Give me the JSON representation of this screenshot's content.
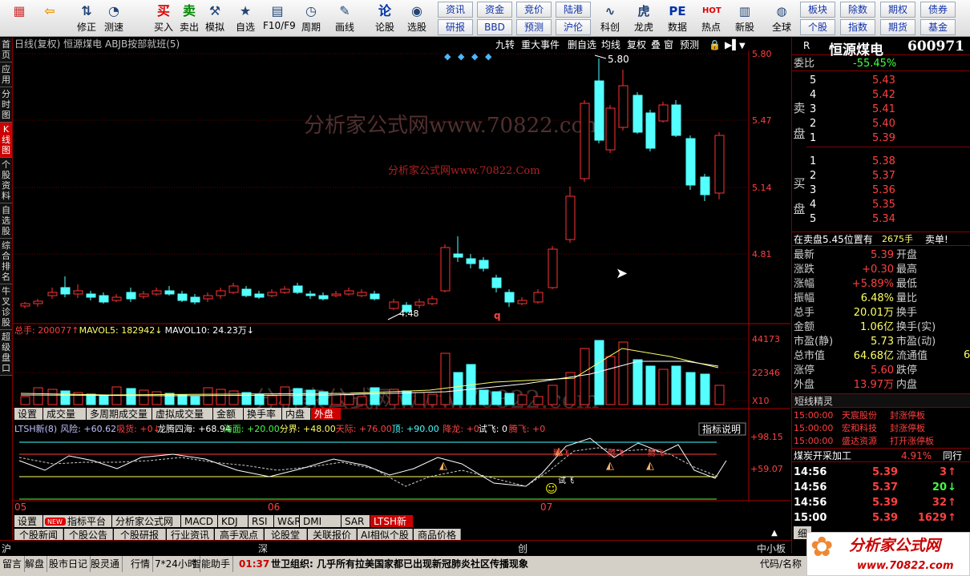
{
  "toolbar": {
    "buttons": [
      {
        "label": "",
        "icon": "grid-icon"
      },
      {
        "label": "",
        "icon": "back-arrow-icon"
      },
      {
        "label": "修正",
        "icon": "up-down-icon"
      },
      {
        "label": "测速",
        "icon": "speed-icon"
      },
      {
        "label": "买入",
        "icon": "buy-icon",
        "glyph": "买"
      },
      {
        "label": "卖出",
        "icon": "sell-icon",
        "glyph": "卖"
      },
      {
        "label": "模拟",
        "icon": "hammer-icon"
      },
      {
        "label": "自选",
        "icon": "star-folder-icon"
      },
      {
        "label": "F10/F9",
        "icon": "f10-icon"
      },
      {
        "label": "周期",
        "icon": "period-icon"
      },
      {
        "label": "画线",
        "icon": "pen-icon"
      },
      {
        "label": "论股",
        "icon": "discuss-icon",
        "glyph": "论"
      },
      {
        "label": "选股",
        "icon": "select-stock-icon"
      }
    ],
    "small": [
      [
        "资讯",
        "资金",
        "竞价",
        "陆港"
      ],
      [
        "研报",
        "BBD",
        "预测",
        "沪伦"
      ]
    ],
    "buttons2": [
      {
        "label": "科创",
        "icon": "kechuang-icon"
      },
      {
        "label": "龙虎",
        "icon": "dragon-tiger-icon"
      },
      {
        "label": "数据",
        "icon": "pe-icon",
        "glyph": "PE"
      },
      {
        "label": "热点",
        "icon": "hot-icon",
        "glyph": "HOT"
      },
      {
        "label": "新股",
        "icon": "new-stock-icon"
      },
      {
        "label": "全球",
        "icon": "globe-icon"
      }
    ],
    "small2": [
      [
        "板块",
        "除数",
        "期权",
        "债券"
      ],
      [
        "个股",
        "指数",
        "期货",
        "基金"
      ]
    ]
  },
  "left_tabs": [
    "首页",
    "应用",
    "分时图",
    "K线图",
    "个股资料",
    "自选股",
    "综合排名",
    "牛叉诊股",
    "超级盘口"
  ],
  "chart": {
    "title": "日线(复权) 恒源煤电 ABJB按部就班(5)",
    "top_buttons": [
      "九转",
      "重大事件",
      "删自选",
      "均线",
      "复权",
      "叠",
      "窗",
      "预测"
    ],
    "watermark1": "分析家公式网www.70822.com",
    "watermark2": "分析家公式网www.70822.Com",
    "price_axis": [
      "5.80",
      "5.47",
      "5.14",
      "4.81"
    ],
    "high_label": "5.80",
    "low_label": "4.48",
    "vol_legend": [
      {
        "t": "总手: 200077↑",
        "c": "#ff4040"
      },
      {
        "t": "MAVOL5: 182942↓",
        "c": "#ffff66"
      },
      {
        "t": "MAVOL10: 24.23万↓",
        "c": "#ffffff"
      }
    ],
    "vol_axis": [
      "44173",
      "22346",
      "X10"
    ],
    "ind_tabs": [
      "设置",
      "成交量",
      "多周期成交量",
      "虚拟成交量",
      "金额",
      "换手率",
      "内盘",
      "外盘"
    ],
    "ind_legend": [
      {
        "t": "LTSH新(8)",
        "c": "#c0c0ff"
      },
      {
        "t": "风险: +60.62",
        "c": "#c0c0ff"
      },
      {
        "t": "吸货: +0↓",
        "c": "#ff4040"
      },
      {
        "t": "龙腾四海: +68.94",
        "c": "#fff"
      },
      {
        "t": "海面: +20.00",
        "c": "#4f4"
      },
      {
        "t": "分界: +48.00",
        "c": "#ff6"
      },
      {
        "t": "天际: +76.00",
        "c": "#f44"
      },
      {
        "t": "顶: +90.00",
        "c": "#4ff"
      },
      {
        "t": "降龙: +0",
        "c": "#f44"
      },
      {
        "t": "试飞: 0",
        "c": "#fff"
      },
      {
        "t": "腾飞: +0",
        "c": "#f44"
      }
    ],
    "ind_btn": "指标说明",
    "ind_axis": [
      "+98.15",
      "+59.07"
    ],
    "ind_marks": [
      "腾飞",
      "腾飞",
      "腾飞",
      "试飞"
    ],
    "date_labels": [
      "05",
      "06",
      "07"
    ],
    "bottom_tabs": [
      "设置",
      "指标平台",
      "分析家公式网",
      "MACD",
      "KDJ",
      "RSI",
      "W&R",
      "DMI",
      "SAR",
      "LTSH新"
    ],
    "new_badge": "NEW",
    "news_tabs": [
      "个股新闻",
      "个股公告",
      "个股研报",
      "行业资讯",
      "高手观点",
      "论股堂",
      "关联报价",
      "AI相似个股",
      "商品价格"
    ]
  },
  "quote": {
    "name": "恒源煤电",
    "code": "600971",
    "r": "R",
    "webi_label": "委比",
    "webi": "-55.45%",
    "sell_label": [
      "卖",
      "盘"
    ],
    "buy_label": [
      "买",
      "盘"
    ],
    "asks": [
      [
        "5",
        "5.43"
      ],
      [
        "4",
        "5.42"
      ],
      [
        "3",
        "5.41"
      ],
      [
        "2",
        "5.40"
      ],
      [
        "1",
        "5.39"
      ]
    ],
    "bids": [
      [
        "1",
        "5.38"
      ],
      [
        "2",
        "5.37"
      ],
      [
        "3",
        "5.36"
      ],
      [
        "4",
        "5.35"
      ],
      [
        "5",
        "5.34"
      ]
    ],
    "msg": "在卖盘5.45位置有",
    "msg_num": "2675手",
    "msg_tail": "卖单!",
    "stats": [
      [
        "最新",
        "5.39",
        "开盘"
      ],
      [
        "涨跌",
        "+0.30",
        "最高"
      ],
      [
        "涨幅",
        "+5.89%",
        "最低"
      ],
      [
        "振幅",
        "6.48%",
        "量比"
      ],
      [
        "总手",
        "20.01万",
        "换手"
      ],
      [
        "金额",
        "1.06亿",
        "换手(实)"
      ],
      [
        "市盈(静)",
        "5.73",
        "市盈(动)"
      ],
      [
        "总市值",
        "64.68亿",
        "流通值"
      ],
      [
        "涨停",
        "5.60",
        "跌停"
      ],
      [
        "外盘",
        "13.97万",
        "内盘"
      ]
    ],
    "stat_val_colors": [
      "#ff4040",
      "#ff4040",
      "#ff4040",
      "#ffff66",
      "#ffff66",
      "#ffff66",
      "#ffff66",
      "#ffff66",
      "#ff4040",
      "#ff4040"
    ],
    "extra": "6",
    "short_title": "短线精灵",
    "short_rows": [
      [
        "15:00:00",
        "天宸股份",
        "封涨停板"
      ],
      [
        "15:00:00",
        "宏和科技",
        "封涨停板"
      ],
      [
        "15:00:00",
        "盛达资源",
        "打开涨停板"
      ]
    ],
    "industry": "煤炭开采加工",
    "industry_pct": "4.91%",
    "industry_btn": "同行",
    "ticks": [
      [
        "14:56",
        "5.39",
        "3",
        "#ff4040"
      ],
      [
        "14:56",
        "5.37",
        "20",
        "#40ff40"
      ],
      [
        "14:56",
        "5.39",
        "32",
        "#ff4040"
      ],
      [
        "15:00",
        "5.39",
        "1629",
        "#ff4040"
      ]
    ],
    "bottom_tab": "细"
  },
  "status": {
    "markets": [
      "沪",
      "深",
      "创"
    ],
    "items": [
      "留言",
      "解盘",
      "股市日记",
      "股灵通",
      "行情",
      "7*24小时",
      "智能助手"
    ],
    "news_time": "01:37",
    "news": "世卫组织: 几乎所有拉美国家都已出现新冠肺炎社区传播现象",
    "right": [
      "中小板",
      "代码/名称"
    ],
    "logo": "分析家公式网",
    "url": "www.70822.com"
  }
}
